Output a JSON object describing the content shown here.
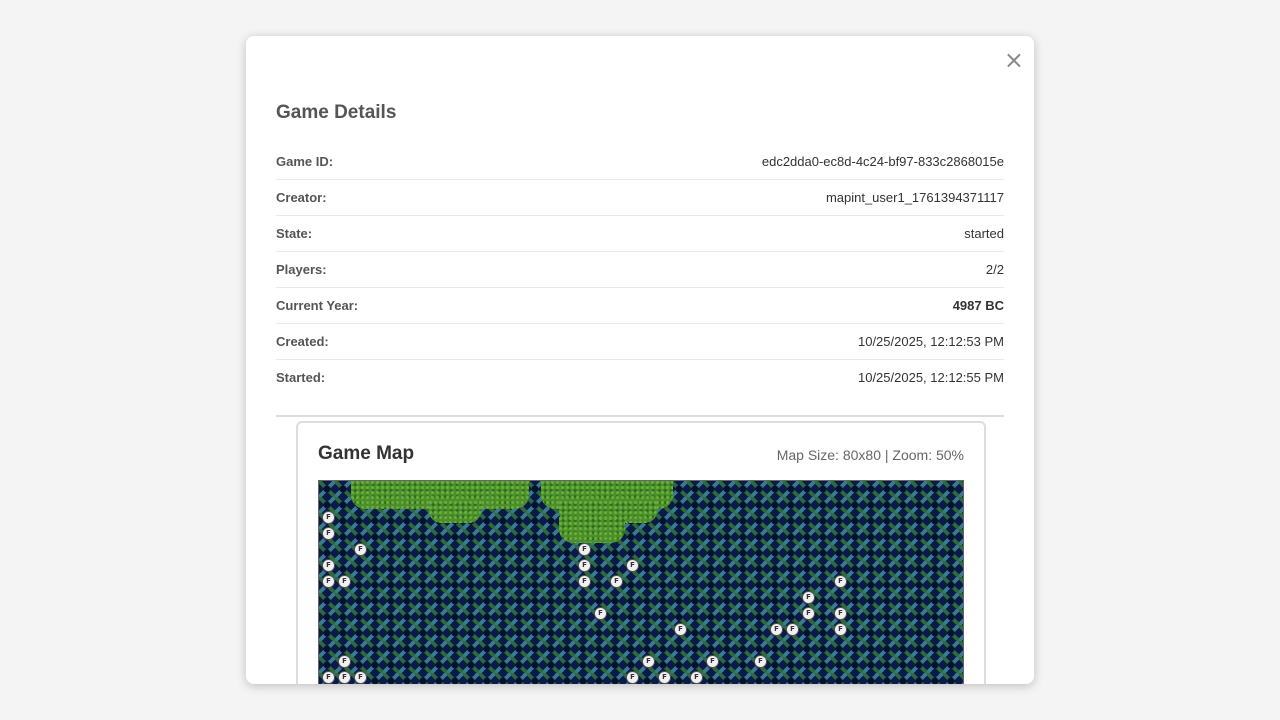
{
  "modal": {
    "title": "Game Details",
    "close_label": "×"
  },
  "details": [
    {
      "label": "Game ID:",
      "value": "edc2dda0-ec8d-4c24-bf97-833c2868015e"
    },
    {
      "label": "Creator:",
      "value": "mapint_user1_1761394371117"
    },
    {
      "label": "State:",
      "value": "started"
    },
    {
      "label": "Players:",
      "value": "2/2"
    },
    {
      "label": "Current Year:",
      "value": "4987 BC"
    },
    {
      "label": "Created:",
      "value": "10/25/2025, 12:12:53 PM"
    },
    {
      "label": "Started:",
      "value": "10/25/2025, 12:12:55 PM"
    }
  ],
  "map": {
    "title": "Game Map",
    "info": "Map Size: 80x80 | Zoom: 50%",
    "unit_label": "F"
  }
}
